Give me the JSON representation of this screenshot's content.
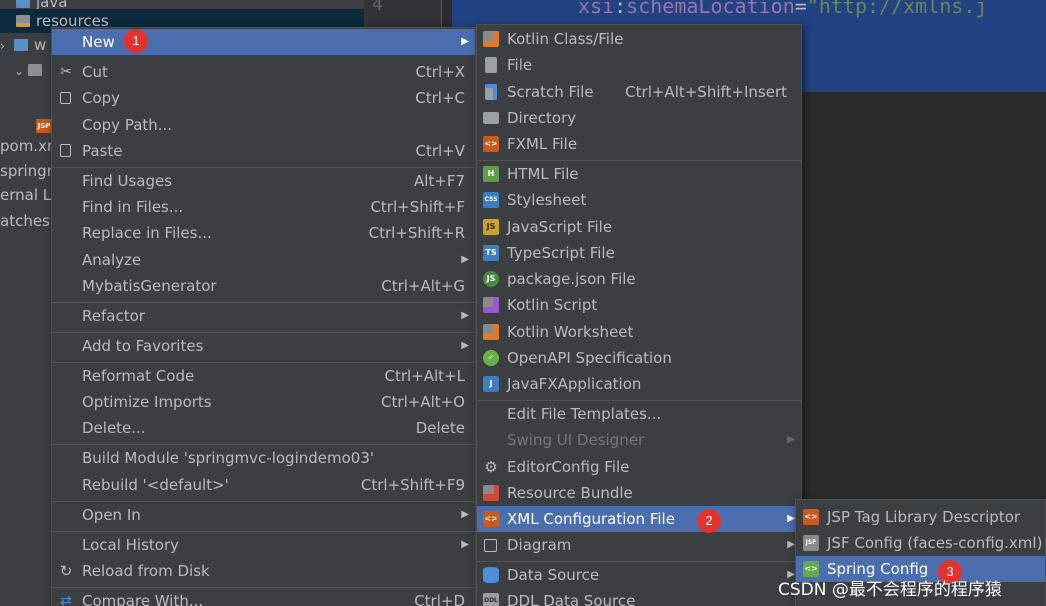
{
  "tree": {
    "java": "java",
    "resources": "resources",
    "webapp": "w",
    "pom": "pom.xm",
    "springmvc": "springm",
    "external": "ernal Lib",
    "scratches": "atches a"
  },
  "editor": {
    "line_number": "4",
    "attr_prefix": "xsi",
    "attr_colon": ":",
    "attr_name": "schemaLocation",
    "attr_eq": "=",
    "attr_value": "\"http://xmlns.j"
  },
  "context_menu": {
    "new": "New",
    "cut": "Cut",
    "cut_sc": "Ctrl+X",
    "copy": "Copy",
    "copy_sc": "Ctrl+C",
    "copy_path": "Copy Path...",
    "paste": "Paste",
    "paste_sc": "Ctrl+V",
    "find_usages": "Find Usages",
    "find_usages_sc": "Alt+F7",
    "find_in_files": "Find in Files...",
    "find_in_files_sc": "Ctrl+Shift+F",
    "replace_in_files": "Replace in Files...",
    "replace_in_files_sc": "Ctrl+Shift+R",
    "analyze": "Analyze",
    "mybatis": "MybatisGenerator",
    "mybatis_sc": "Ctrl+Alt+G",
    "refactor": "Refactor",
    "add_favorites": "Add to Favorites",
    "reformat": "Reformat Code",
    "reformat_sc": "Ctrl+Alt+L",
    "optimize": "Optimize Imports",
    "optimize_sc": "Ctrl+Alt+O",
    "delete": "Delete...",
    "delete_sc": "Delete",
    "build_module": "Build Module 'springmvc-logindemo03'",
    "rebuild": "Rebuild '<default>'",
    "rebuild_sc": "Ctrl+Shift+F9",
    "open_in": "Open In",
    "local_history": "Local History",
    "reload": "Reload from Disk",
    "compare": "Compare With...",
    "compare_sc": "Ctrl+D"
  },
  "new_menu": {
    "kotlin_class": "Kotlin Class/File",
    "file": "File",
    "scratch": "Scratch File",
    "scratch_sc": "Ctrl+Alt+Shift+Insert",
    "directory": "Directory",
    "fxml": "FXML File",
    "html": "HTML File",
    "stylesheet": "Stylesheet",
    "javascript": "JavaScript File",
    "typescript": "TypeScript File",
    "package_json": "package.json File",
    "kotlin_script": "Kotlin Script",
    "kotlin_worksheet": "Kotlin Worksheet",
    "openapi": "OpenAPI Specification",
    "javafx": "JavaFXApplication",
    "edit_templates": "Edit File Templates...",
    "swing": "Swing UI Designer",
    "editorconfig": "EditorConfig File",
    "resource_bundle": "Resource Bundle",
    "xml_config": "XML Configuration File",
    "diagram": "Diagram",
    "data_source": "Data Source",
    "ddl_source": "DDL Data Source"
  },
  "xml_menu": {
    "jsp_tld": "JSP Tag Library Descriptor",
    "jsf_config": "JSF Config (faces-config.xml)",
    "spring_config": "Spring Config"
  },
  "badges": {
    "b1": "1",
    "b2": "2",
    "b3": "3"
  },
  "watermark": "CSDN @最不会程序的程序猿",
  "colors": {
    "accent": "#4b6eaf",
    "badge": "#e5322d",
    "menu_bg": "#3c3f41"
  }
}
